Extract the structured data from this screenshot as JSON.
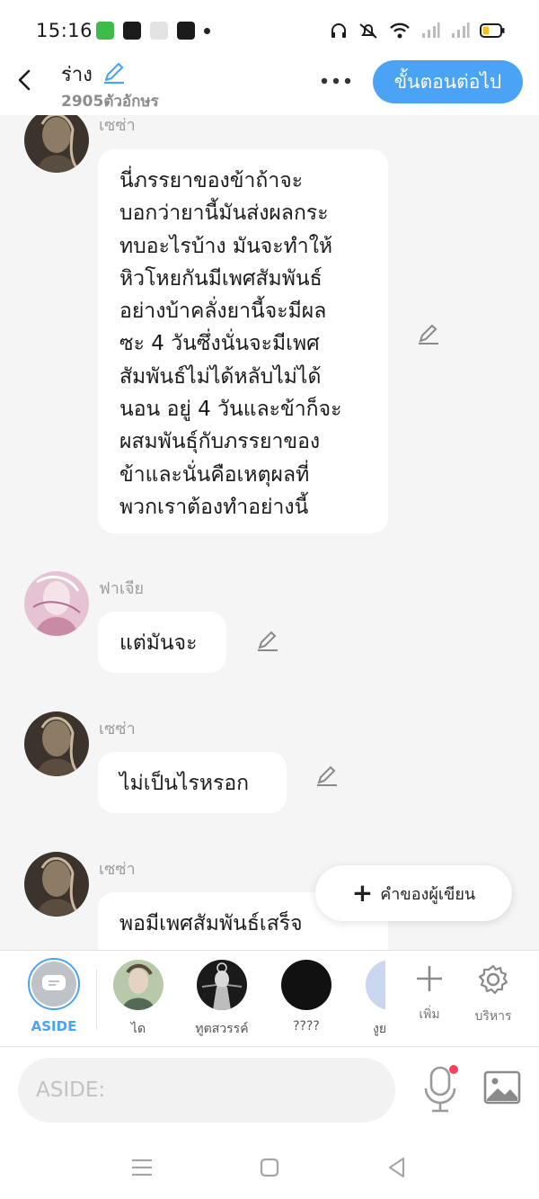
{
  "status": {
    "time": "15:16"
  },
  "header": {
    "title": "ร่าง",
    "char_count": "2905ตัวอักษร",
    "next_label": "ขั้นตอนต่อไป"
  },
  "messages": [
    {
      "sender": "เซซ่า",
      "text": "นี่ภรรยาของข้าถ้าจะ\nบอกว่ายานี้มันส่งผลกระ\nทบอะไรบ้าง มันจะทำให้\nหิวโหยกันมีเพศสัมพันธ์\nอย่างบ้าคลั่งยานี้จะมีผล\nซะ 4 วันซึ่งนั่นจะมีเพศ\nสัมพันธ์ไม่ได้หลับไม่ได้\nนอน อยู่ 4 วันและข้าก็จะ\nผสมพันธุ์กับภรรยาของ\nข้าและนั่นคือเหตุผลที่\nพวกเราต้องทำอย่างนี้"
    },
    {
      "sender": "ฟาเจีย",
      "text": "แต่มันจะ"
    },
    {
      "sender": "เซซ่า",
      "text": "ไม่เป็นไรหรอก"
    },
    {
      "sender": "เซซ่า",
      "text": "พอมีเพศสัมพันธ์เสร็จ"
    }
  ],
  "author_button": {
    "label": "คำของผู้เขียน"
  },
  "characters": [
    {
      "label": "ASIDE"
    },
    {
      "label": "ได"
    },
    {
      "label": "ทูตสวรรค์"
    },
    {
      "label": "????"
    },
    {
      "label": "งูย"
    }
  ],
  "tools": {
    "add_label": "เพิ่ม",
    "manage_label": "บริหาร"
  },
  "input": {
    "placeholder": "ASIDE:"
  },
  "colors": {
    "accent": "#4aa3f5",
    "bubble": "#ffffff",
    "background": "#f5f5f5"
  }
}
